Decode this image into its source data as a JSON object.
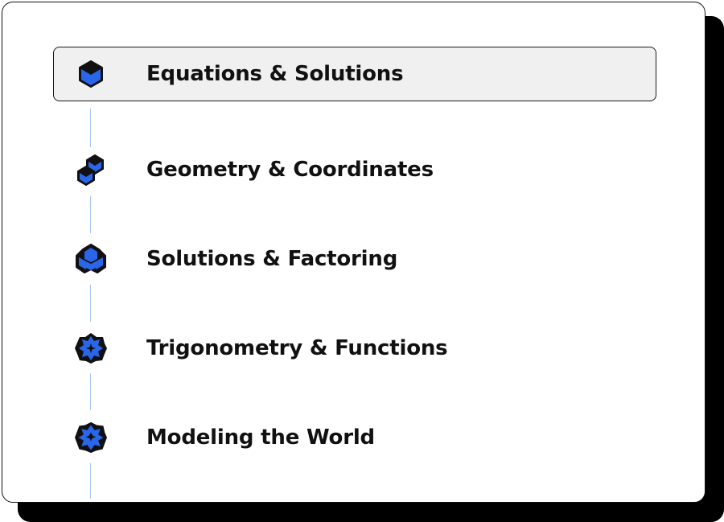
{
  "lessons": [
    {
      "label": "Equations & Solutions",
      "icon": "single-cube-icon",
      "active": true
    },
    {
      "label": "Geometry & Coordinates",
      "icon": "two-cubes-icon",
      "active": false
    },
    {
      "label": "Solutions & Factoring",
      "icon": "three-cubes-icon",
      "active": false
    },
    {
      "label": "Trigonometry & Functions",
      "icon": "cube-flower-icon",
      "active": false
    },
    {
      "label": "Modeling the World",
      "icon": "cube-star-icon",
      "active": false
    }
  ],
  "colors": {
    "accent": "#2a66ea",
    "ink": "#111111",
    "connector": "#aac6ef",
    "active_bg": "#f0f0f0"
  }
}
